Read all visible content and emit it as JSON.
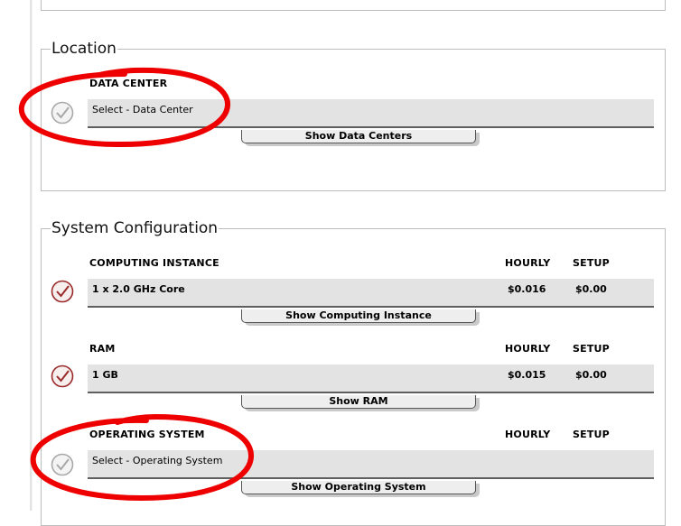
{
  "location": {
    "legend": "Location",
    "data_center": {
      "label": "DATA CENTER",
      "value": "Select - Data Center",
      "button": "Show Data Centers"
    }
  },
  "system_configuration": {
    "legend": "System Configuration",
    "columns": {
      "hourly": "HOURLY",
      "setup": "SETUP"
    },
    "computing_instance": {
      "label": "COMPUTING INSTANCE",
      "value": "1 x 2.0 GHz Core",
      "hourly": "$0.016",
      "setup": "$0.00",
      "button": "Show Computing Instance"
    },
    "ram": {
      "label": "RAM",
      "value": "1 GB",
      "hourly": "$0.015",
      "setup": "$0.00",
      "button": "Show RAM"
    },
    "operating_system": {
      "label": "OPERATING SYSTEM",
      "value": "Select - Operating System",
      "button": "Show Operating System"
    }
  },
  "colors": {
    "annotation": "#ee0000",
    "check_selected": "#9a2a2a",
    "check_unselected": "#a8a8a8",
    "bar": "#e3e3e3"
  }
}
